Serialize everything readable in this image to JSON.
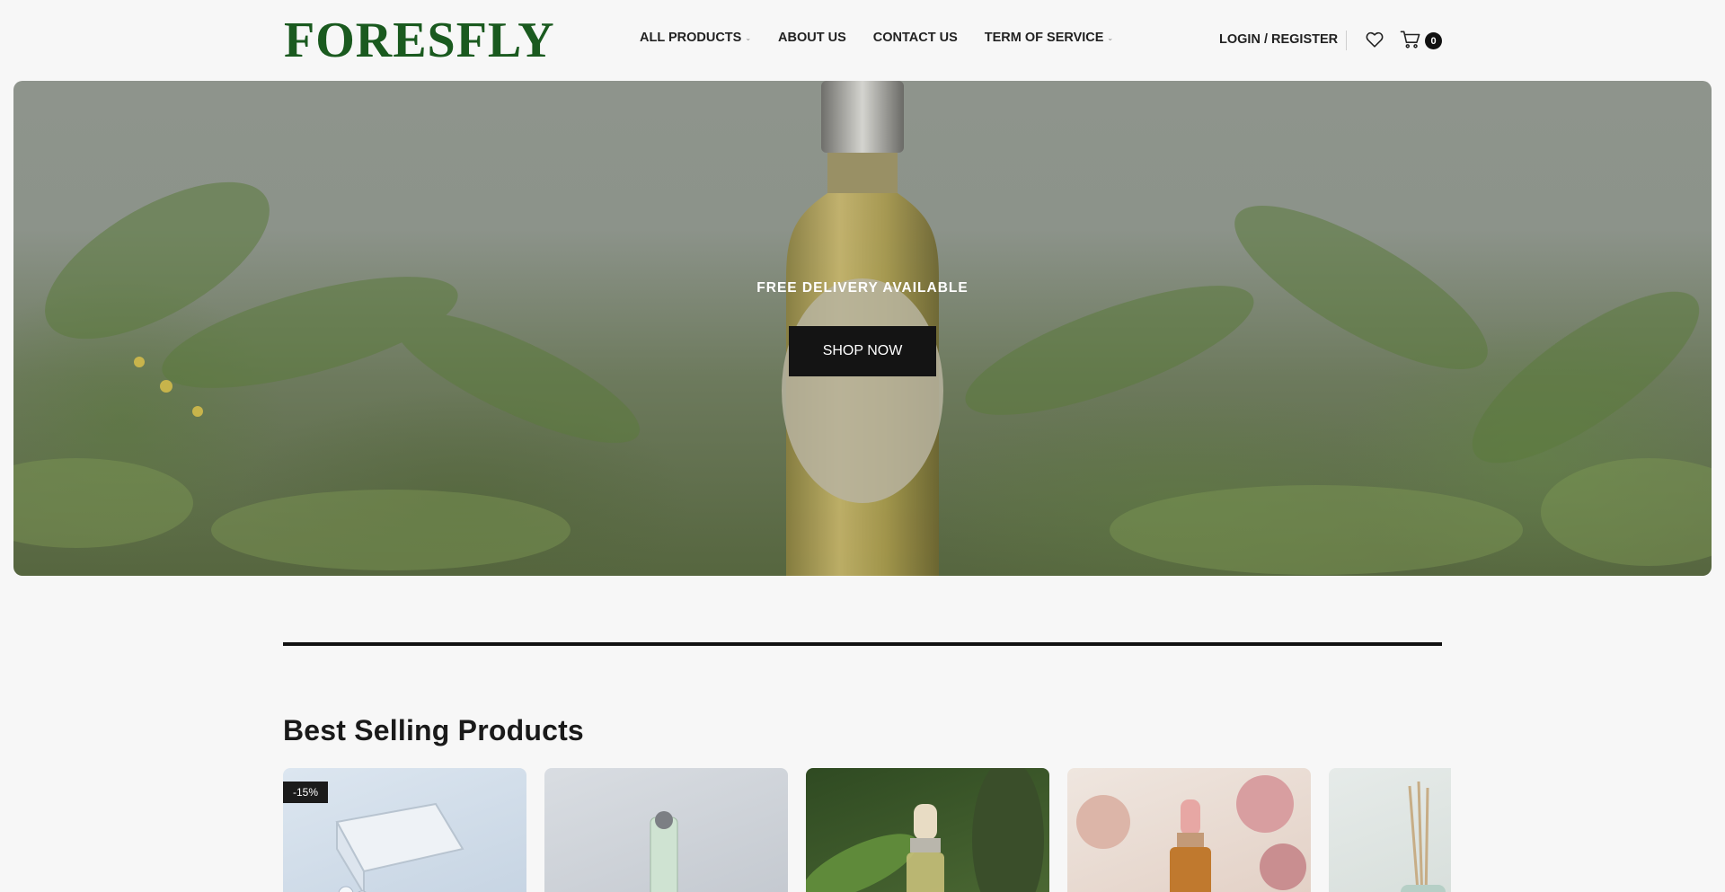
{
  "brand": {
    "logo": "FORESFLY"
  },
  "nav": {
    "items": [
      {
        "label": "ALL PRODUCTS",
        "dropdown": true
      },
      {
        "label": "ABOUT US",
        "dropdown": false
      },
      {
        "label": "CONTACT US",
        "dropdown": false
      },
      {
        "label": "TERM OF SERVICE",
        "dropdown": true
      }
    ]
  },
  "account": {
    "label": "LOGIN / REGISTER"
  },
  "icons": {
    "wishlist": "heart-icon",
    "cart": "cart-icon",
    "dropdown": "chevron-down-icon"
  },
  "cart": {
    "count": "0"
  },
  "hero": {
    "tagline": "FREE DELIVERY AVAILABLE",
    "button": "SHOP NOW"
  },
  "section": {
    "title": "Best Selling Products"
  },
  "products": [
    {
      "badge": "-15%",
      "image": "bead-box-image"
    },
    {
      "badge": "",
      "image": "roller-bottle-image"
    },
    {
      "badge": "",
      "image": "serum-forest-image"
    },
    {
      "badge": "",
      "image": "dropper-roses-image"
    },
    {
      "badge": "",
      "image": "reed-diffuser-image"
    }
  ],
  "colors": {
    "brand_green": "#1a5a1f",
    "button_dark": "#141414",
    "page_bg": "#f7f7f7"
  }
}
